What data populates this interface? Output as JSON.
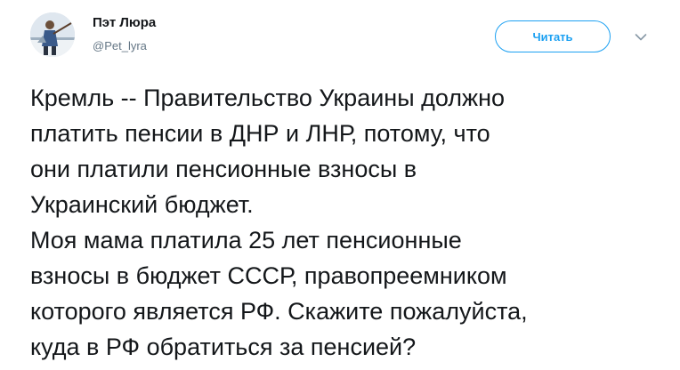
{
  "author": {
    "name": "Пэт Люра",
    "handle": "@Pet_lyra",
    "avatar_icon": "user-avatar-photo"
  },
  "actions": {
    "follow_label": "Читать",
    "menu_icon": "chevron-down-icon"
  },
  "colors": {
    "accent": "#1da1f2",
    "text": "#14171a",
    "secondary_text": "#657786"
  },
  "tweet": {
    "lines": [
      "Кремль -- Правительство Украины должно",
      "платить пенсии в ДНР и ЛНР, потому, что",
      "они платили пенсионные взносы в",
      "Украинский бюджет.",
      "Моя мама платила 25 лет пенсионные",
      "взносы в бюджет СССР, правопреемником",
      "которого является РФ. Скажите пожалуйста,",
      "куда в РФ обратиться за пенсией?"
    ]
  }
}
